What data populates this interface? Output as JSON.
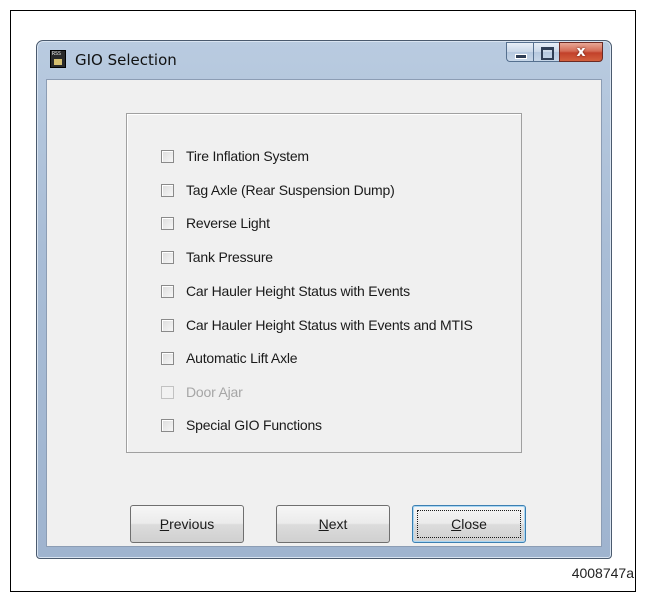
{
  "window": {
    "title": "GIO Selection",
    "icon_name": "app-icon",
    "icon_text": "RSS",
    "controls": {
      "minimize_icon": "minimize-icon",
      "maximize_icon": "maximize-icon",
      "close_icon": "close-icon",
      "close_glyph": "x"
    }
  },
  "options": [
    {
      "label": "Tire Inflation System",
      "checked": false,
      "enabled": true
    },
    {
      "label": "Tag Axle (Rear Suspension Dump)",
      "checked": false,
      "enabled": true
    },
    {
      "label": "Reverse Light",
      "checked": false,
      "enabled": true
    },
    {
      "label": "Tank Pressure",
      "checked": false,
      "enabled": true
    },
    {
      "label": "Car Hauler Height Status with Events",
      "checked": false,
      "enabled": true
    },
    {
      "label": "Car Hauler Height Status with Events and MTIS",
      "checked": false,
      "enabled": true
    },
    {
      "label": "Automatic Lift Axle",
      "checked": false,
      "enabled": true
    },
    {
      "label": "Door Ajar",
      "checked": false,
      "enabled": false
    },
    {
      "label": "Special GIO Functions",
      "checked": false,
      "enabled": true
    }
  ],
  "buttons": {
    "previous": {
      "mnemonic": "P",
      "rest": "revious"
    },
    "next": {
      "mnemonic": "N",
      "rest": "ext"
    },
    "close": {
      "mnemonic": "C",
      "rest": "lose"
    }
  },
  "figure_id": "4008747a",
  "colors": {
    "title_bar": "#a9bdd6",
    "close_button": "#c2412a",
    "client_background": "#f0f0f0",
    "disabled_text": "#a6a6a6"
  }
}
